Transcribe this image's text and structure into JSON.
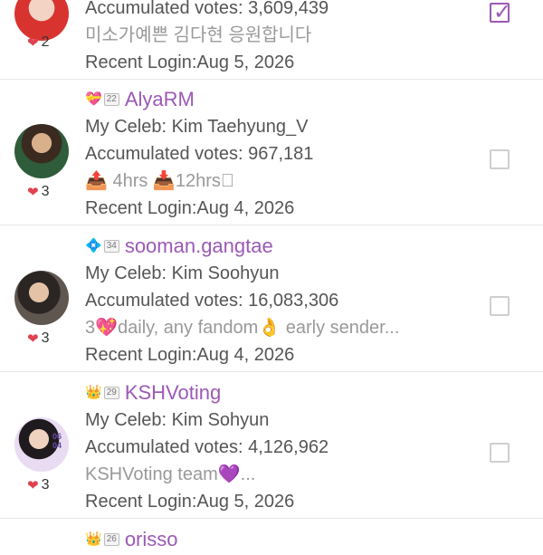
{
  "colors": {
    "accent": "#9b59b6",
    "heart": "#e0424f",
    "text": "#555555",
    "muted": "#999999",
    "divider": "#e6e6e6"
  },
  "rows": [
    {
      "votes_line": "Accumulated votes: 3,609,439",
      "message": "미소가예쁜 김다현 응원합니다",
      "login": "Recent Login:Aug 5, 2026",
      "hearts": "2",
      "checked": true
    },
    {
      "badge_level": "22",
      "badge_icon": "pink-heart-badge-icon",
      "username": "AlyaRM",
      "celeb": "My Celeb: Kim Taehyung_V",
      "votes_line": "Accumulated votes: 967,181",
      "message": "📤 4hrs  📥12hrs⃣",
      "login": "Recent Login:Aug 4, 2026",
      "hearts": "3",
      "checked": false
    },
    {
      "badge_level": "34",
      "badge_icon": "blue-diamond-badge-icon",
      "username": "sooman.gangtae",
      "celeb": "My Celeb: Kim Soohyun",
      "votes_line": "Accumulated votes: 16,083,306",
      "message": "3💖daily, any fandom👌 early sender...",
      "login": "Recent Login:Aug 4, 2026",
      "hearts": "3",
      "checked": false
    },
    {
      "badge_level": "29",
      "badge_icon": "gold-crown-badge-icon",
      "username": "KSHVoting",
      "celeb": "My Celeb: Kim Sohyun",
      "votes_line": "Accumulated votes: 4,126,962",
      "message": "KSHVoting team💜...",
      "login": "Recent Login:Aug 5, 2026",
      "hearts": "3",
      "checked": false,
      "avatar_text": "06 04"
    },
    {
      "badge_level": "26",
      "badge_icon": "gold-crown-badge-icon",
      "username": "orisso"
    }
  ]
}
